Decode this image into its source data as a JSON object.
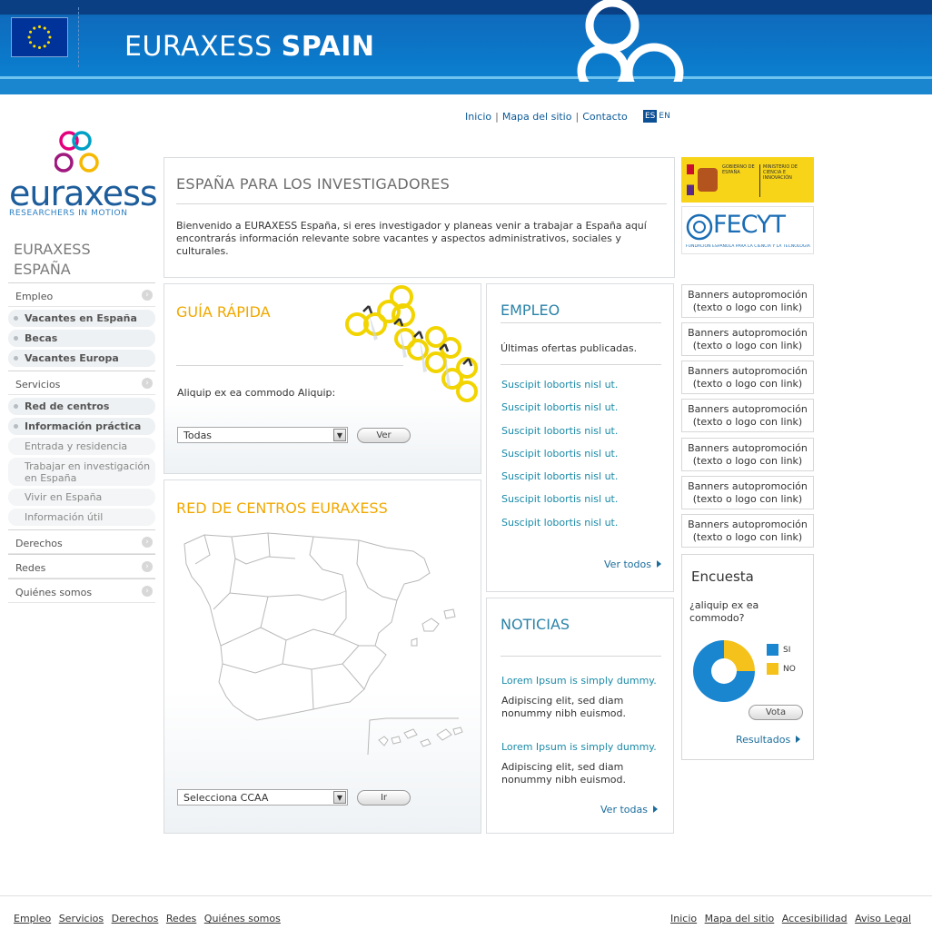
{
  "header": {
    "title": "EURAXESS",
    "title_bold": "SPAIN"
  },
  "topnav": {
    "inicio": "Inicio",
    "mapa": "Mapa del sitio",
    "contacto": "Contacto",
    "separator": "|",
    "lang_es": "ES",
    "lang_en": "EN"
  },
  "logo": {
    "word": "euraxess",
    "tagline": "RESEARCHERS IN MOTION"
  },
  "sidebar": {
    "title_line1": "EURAXESS",
    "title_line2": "ESPAÑA",
    "empleo": "Empleo",
    "vacantes_espana": "Vacantes en España",
    "becas": "Becas",
    "vacantes_europa": "Vacantes Europa",
    "servicios": "Servicios",
    "red_centros": "Red de centros",
    "informacion_practica": "Información práctica",
    "entrada": "Entrada y residencia",
    "trabajar": "Trabajar en investigación en España",
    "vivir": "Vivir en España",
    "info_util": "Información útil",
    "derechos": "Derechos",
    "redes": "Redes",
    "quienes": "Quiénes somos"
  },
  "intro": {
    "title": "ESPAÑA PARA LOS INVESTIGADORES",
    "text": "Bienvenido a EURAXESS España, si eres investigador y planeas venir a trabajar a España aquí encontrarás información relevante sobre vacantes y aspectos administrativos, sociales y culturales."
  },
  "guia": {
    "title": "GUÍA RÁPIDA",
    "question": "Aliquip ex ea commodo Aliquip:",
    "select_value": "Todas",
    "button": "Ver"
  },
  "red": {
    "title": "RED DE CENTROS EURAXESS",
    "select_value": "Selecciona CCAA",
    "button": "Ir"
  },
  "empleo": {
    "title": "EMPLEO",
    "subtitle": "Últimas ofertas publicadas.",
    "links": [
      "Suscipit lobortis nisl ut.",
      "Suscipit lobortis nisl ut.",
      "Suscipit lobortis nisl ut.",
      "Suscipit lobortis nisl ut.",
      "Suscipit lobortis nisl ut.",
      "Suscipit lobortis nisl ut.",
      "Suscipit lobortis nisl ut."
    ],
    "more": "Ver todos"
  },
  "noticias": {
    "title": "NOTICIAS",
    "items": [
      {
        "title": "Lorem Ipsum is simply dummy.",
        "body": "Adipiscing elit, sed diam nonummy nibh euismod."
      },
      {
        "title": "Lorem Ipsum is simply dummy.",
        "body": "Adipiscing elit, sed diam nonummy nibh euismod."
      }
    ],
    "more": "Ver todas"
  },
  "right": {
    "gob_1": "GOBIERNO DE ESPAÑA",
    "gob_2": "MINISTERIO DE CIENCIA E INNOVACIÓN",
    "fecyt": "FECYT",
    "fecyt_sub": "FUNDACIÓN ESPAÑOLA PARA LA CIENCIA Y LA TECNOLOGÍA",
    "banners": [
      "Banners autopromoción (texto o logo con link)",
      "Banners autopromoción (texto o logo con link)",
      "Banners autopromoción (texto o logo con link)",
      "Banners autopromoción (texto o logo con link)",
      "Banners autopromoción (texto o logo con link)",
      "Banners autopromoción (texto o logo con link)",
      "Banners autopromoción (texto o logo con link)"
    ]
  },
  "encuesta": {
    "title": "Encuesta",
    "question": "¿aliquip ex ea commodo?",
    "si": "SI",
    "no": "NO",
    "si_fraction": 0.75,
    "no_fraction": 0.25,
    "si_color": "#1a86d0",
    "no_color": "#f5c21b",
    "button": "Vota",
    "results": "Resultados"
  },
  "footer": {
    "left": [
      "Empleo",
      "Servicios",
      "Derechos",
      "Redes",
      "Quiénes somos"
    ],
    "right": [
      "Inicio",
      "Mapa del sitio",
      "Accesibilidad",
      "Aviso Legal"
    ]
  }
}
